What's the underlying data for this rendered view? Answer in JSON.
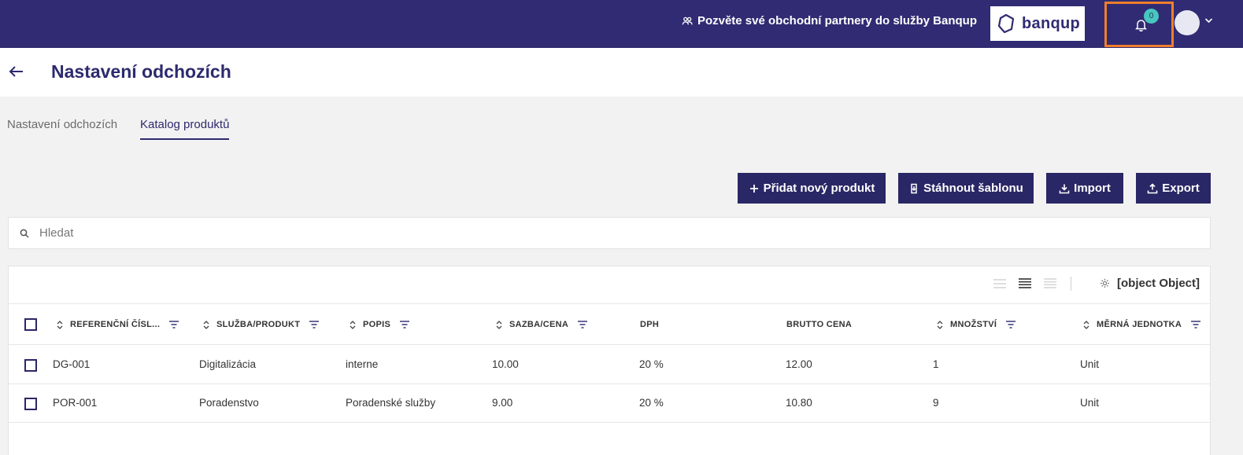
{
  "topbar": {
    "invite_label": "Pozvěte své obchodní partnery do služby Banqup",
    "brand": "banqup",
    "notification_count": "0",
    "colors": {
      "bar": "#302b72",
      "badge": "#49c6bf",
      "highlight": "#f07e2d"
    }
  },
  "page": {
    "title": "Nastavení odchozích"
  },
  "tabs": [
    {
      "label": "Nastavení odchozích",
      "active": false
    },
    {
      "label": "Katalog produktů",
      "active": true
    }
  ],
  "actions": {
    "add": "Přidat nový produkt",
    "template": "Stáhnout šablonu",
    "import": "Import",
    "export": "Export"
  },
  "search": {
    "placeholder": "Hledat",
    "value": ""
  },
  "table": {
    "settings_label": "[object Object]",
    "columns": [
      "REFERENČNÍ ČÍSL...",
      "SLUŽBA/PRODUKT",
      "POPIS",
      "SAZBA/CENA",
      "DPH",
      "BRUTTO CENA",
      "MNOŽSTVÍ",
      "MĚRNÁ JEDNOTKA"
    ],
    "rows": [
      [
        "DG-001",
        "Digitalizácia",
        "interne",
        "10.00",
        "20 %",
        "12.00",
        "1",
        "Unit"
      ],
      [
        "POR-001",
        "Poradenstvo",
        "Poradenské služby",
        "9.00",
        "20 %",
        "10.80",
        "9",
        "Unit"
      ]
    ]
  }
}
